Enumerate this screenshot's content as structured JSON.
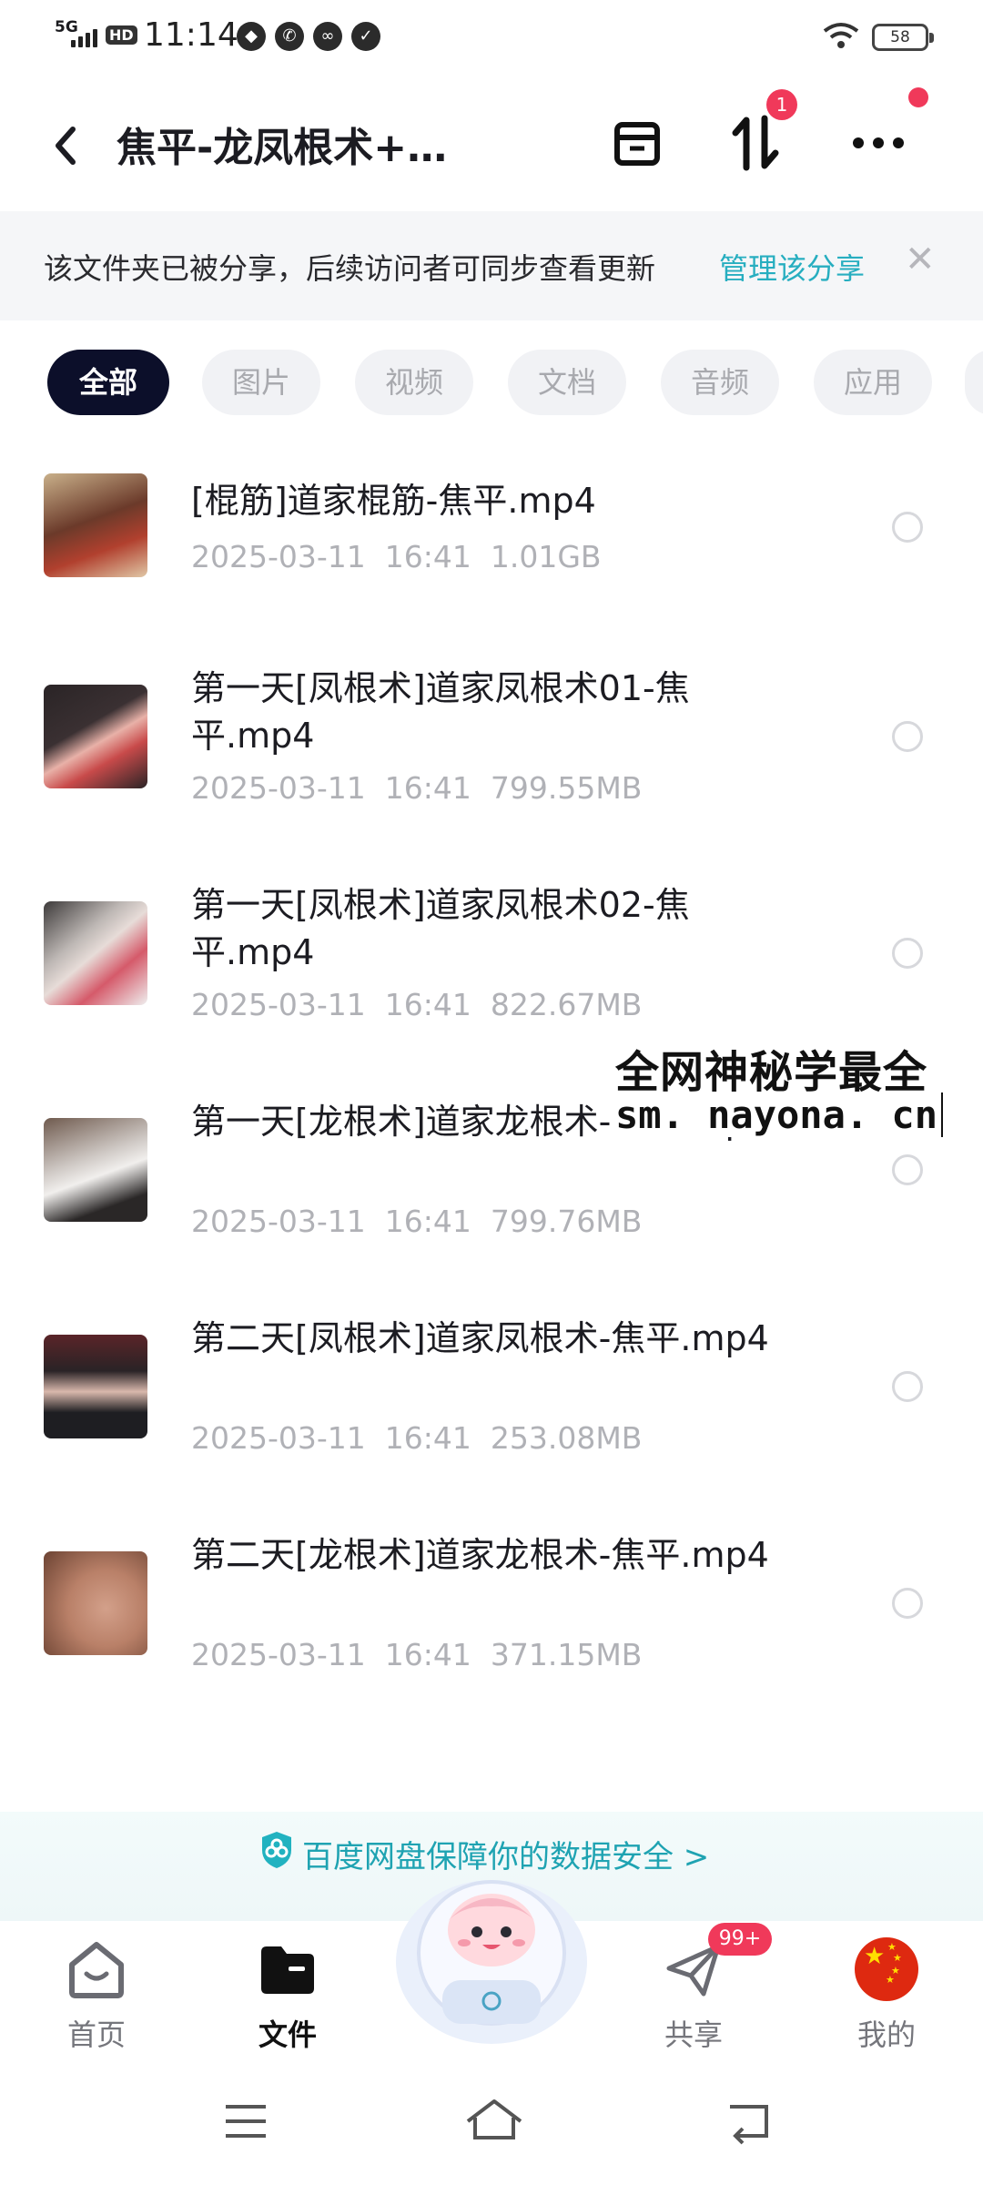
{
  "status_bar": {
    "network": "5G",
    "hd": "HD",
    "time": "11:14",
    "battery": "58"
  },
  "header": {
    "title": "焦平-龙凤根术+…",
    "transfer_badge": "1"
  },
  "share_banner": {
    "text": "该文件夹已被分享，后续访问者可同步查看更新",
    "link": "管理该分享"
  },
  "tabs": [
    "全部",
    "图片",
    "视频",
    "文档",
    "音频",
    "应用"
  ],
  "files": [
    {
      "name": "[棍筋]道家棍筋-焦平.mp4",
      "date": "2025-03-11",
      "time": "16:41",
      "size": "1.01GB"
    },
    {
      "name": "第一天[凤根术]道家凤根术01-焦平.mp4",
      "date": "2025-03-11",
      "time": "16:41",
      "size": "799.55MB"
    },
    {
      "name": "第一天[凤根术]道家凤根术02-焦平.mp4",
      "date": "2025-03-11",
      "time": "16:41",
      "size": "822.67MB"
    },
    {
      "name": "第一天[龙根术]道家龙根术-焦平.mp4",
      "date": "2025-03-11",
      "time": "16:41",
      "size": "799.76MB"
    },
    {
      "name": "第二天[凤根术]道家凤根术-焦平.mp4",
      "date": "2025-03-11",
      "time": "16:41",
      "size": "253.08MB"
    },
    {
      "name": "第二天[龙根术]道家龙根术-焦平.mp4",
      "date": "2025-03-11",
      "time": "16:41",
      "size": "371.15MB"
    }
  ],
  "watermark": {
    "line1": "全网神秘学最全",
    "line2": "sm. nayona. cn"
  },
  "safety_banner": {
    "text": "百度网盘保障你的数据安全 >"
  },
  "bottom_nav": {
    "items": [
      {
        "label": "首页"
      },
      {
        "label": "文件"
      },
      {
        "label": "共享"
      },
      {
        "label": "我的"
      }
    ],
    "share_badge": "99+"
  },
  "colors": {
    "accent": "#27aec0",
    "badge": "#f0395a",
    "tab_active_bg": "#0c0f2a"
  }
}
